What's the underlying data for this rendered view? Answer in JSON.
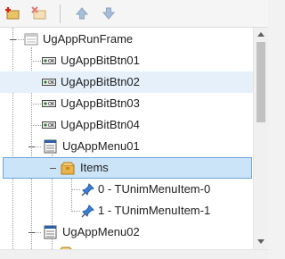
{
  "toolbar": {
    "add_icon": "add-item-icon",
    "delete_icon": "delete-item-icon",
    "move_up_icon": "arrow-up-icon",
    "move_down_icon": "arrow-down-icon"
  },
  "tree": {
    "nodes": [
      {
        "label": "UgAppRunFrame",
        "icon": "frame-icon",
        "selected": false
      },
      {
        "label": "UgAppBitBtn01",
        "icon": "bitbtn-icon",
        "selected": false
      },
      {
        "label": "UgAppBitBtn02",
        "icon": "bitbtn-icon",
        "selected": false
      },
      {
        "label": "UgAppBitBtn03",
        "icon": "bitbtn-icon",
        "selected": false
      },
      {
        "label": "UgAppBitBtn04",
        "icon": "bitbtn-icon",
        "selected": false
      },
      {
        "label": "UgAppMenu01",
        "icon": "menu-icon",
        "selected": false
      },
      {
        "label": "Items",
        "icon": "folder-box-icon",
        "selected": true
      },
      {
        "label": "0 - TUnimMenuItem-0",
        "icon": "pin-icon",
        "selected": false
      },
      {
        "label": "1 - TUnimMenuItem-1",
        "icon": "pin-icon",
        "selected": false
      },
      {
        "label": "UgAppMenu02",
        "icon": "menu-icon",
        "selected": false
      }
    ]
  },
  "colors": {
    "selection_bg": "#cce4f7",
    "selection_border": "#6aa6d9",
    "hover_bg": "#e5f0fb"
  }
}
